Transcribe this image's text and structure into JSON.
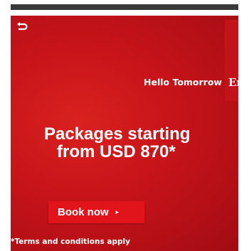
{
  "ad": {
    "replay_icon": "replay-icon",
    "brand_crest_icon": "emirates-crest-icon",
    "tagline": "Hello Tomorrow",
    "brand_name": "Emi",
    "headline_line1": "Packages starting",
    "headline_line2": "from USD 870*",
    "cta_label": "Book now",
    "cta_arrow": "▸",
    "terms": "*Terms and conditions apply",
    "colors": {
      "background": "#c8141a",
      "button": "#e1141b",
      "text": "#ffffff",
      "top_bar": "#3a3a3a"
    }
  }
}
